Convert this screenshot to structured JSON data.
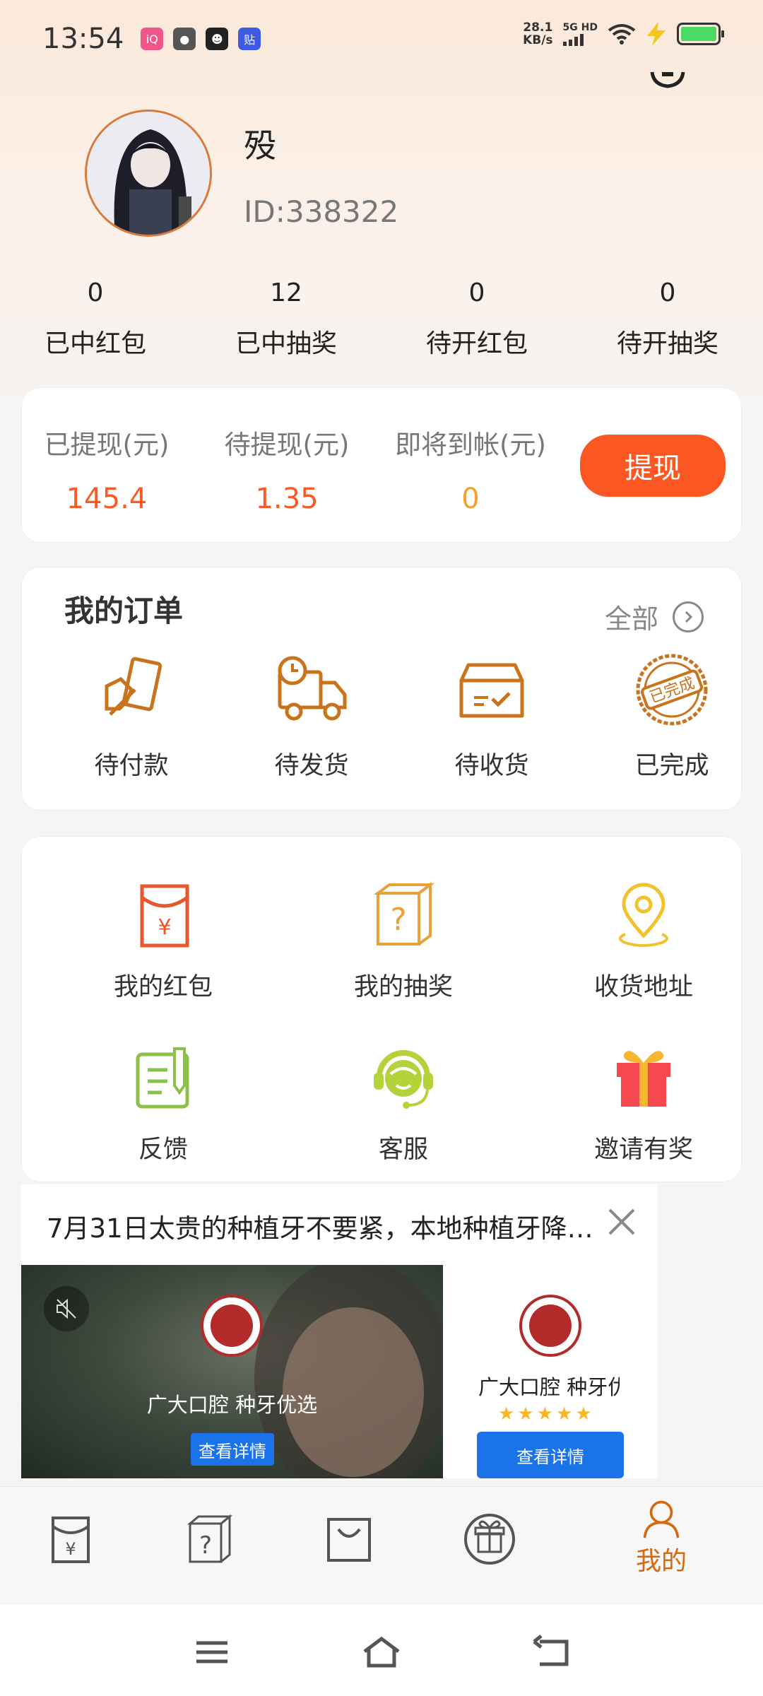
{
  "status_bar": {
    "time": "13:54",
    "net_speed_value": "28.1",
    "net_speed_unit": "KB/s",
    "signal_label": "5G HD",
    "apps": [
      {
        "name": "app-icon-a",
        "color": "#f0568a",
        "glyph": "iQ"
      },
      {
        "name": "wechat-icon",
        "color": "#555555",
        "glyph": "●"
      },
      {
        "name": "qq-icon",
        "color": "#222222",
        "glyph": "☻"
      },
      {
        "name": "tieba-icon",
        "color": "#3d5ae0",
        "glyph": "贴"
      }
    ]
  },
  "profile": {
    "username": "殁",
    "user_id": "ID:338322"
  },
  "stats": [
    {
      "value": "0",
      "label": "已中红包"
    },
    {
      "value": "12",
      "label": "已中抽奖"
    },
    {
      "value": "0",
      "label": "待开红包"
    },
    {
      "value": "0",
      "label": "待开抽奖"
    }
  ],
  "wallet": {
    "withdrawn_label": "已提现(元)",
    "withdrawn_value": "145.4",
    "pending_label": "待提现(元)",
    "pending_value": "1.35",
    "arriving_label": "即将到帐(元)",
    "arriving_value": "0",
    "withdraw_button": "提现",
    "colors": {
      "withdrawn": "#fb5a28",
      "pending": "#fb5a28",
      "arriving": "#f6a02c",
      "button": "#fb5722"
    }
  },
  "orders": {
    "title": "我的订单",
    "all_label": "全部",
    "items": [
      {
        "label": "待付款",
        "icon": "wallet-pay-icon"
      },
      {
        "label": "待发货",
        "icon": "delivery-truck-icon"
      },
      {
        "label": "待收货",
        "icon": "package-box-icon"
      },
      {
        "label": "已完成",
        "icon": "completed-stamp-icon",
        "stamp_text": "已完成"
      }
    ]
  },
  "services": [
    {
      "label": "我的红包",
      "icon": "red-envelope-icon",
      "glyph": "¥"
    },
    {
      "label": "我的抽奖",
      "icon": "mystery-box-icon",
      "glyph": "?"
    },
    {
      "label": "收货地址",
      "icon": "location-pin-icon"
    },
    {
      "label": "反馈",
      "icon": "feedback-note-icon"
    },
    {
      "label": "客服",
      "icon": "customer-service-icon"
    },
    {
      "label": "邀请有奖",
      "icon": "gift-icon"
    }
  ],
  "ad": {
    "title": "7月31日太贵的种植牙不要紧，本地种植牙降…",
    "brand": "广大口腔 种牙优选",
    "brand_side": "广大口腔 种牙优选",
    "detail_button": "查看详情",
    "detail_button_side": "查看详情",
    "rating": 5
  },
  "bottom_nav": {
    "items": [
      {
        "icon": "red-envelope-nav-icon",
        "glyph": "¥",
        "label": ""
      },
      {
        "icon": "mystery-box-nav-icon",
        "glyph": "?",
        "label": ""
      },
      {
        "icon": "shopping-bag-nav-icon",
        "label": ""
      },
      {
        "icon": "gift-nav-icon",
        "label": ""
      },
      {
        "icon": "profile-nav-icon",
        "label": "我的"
      }
    ],
    "active_color": "#d4690d"
  }
}
